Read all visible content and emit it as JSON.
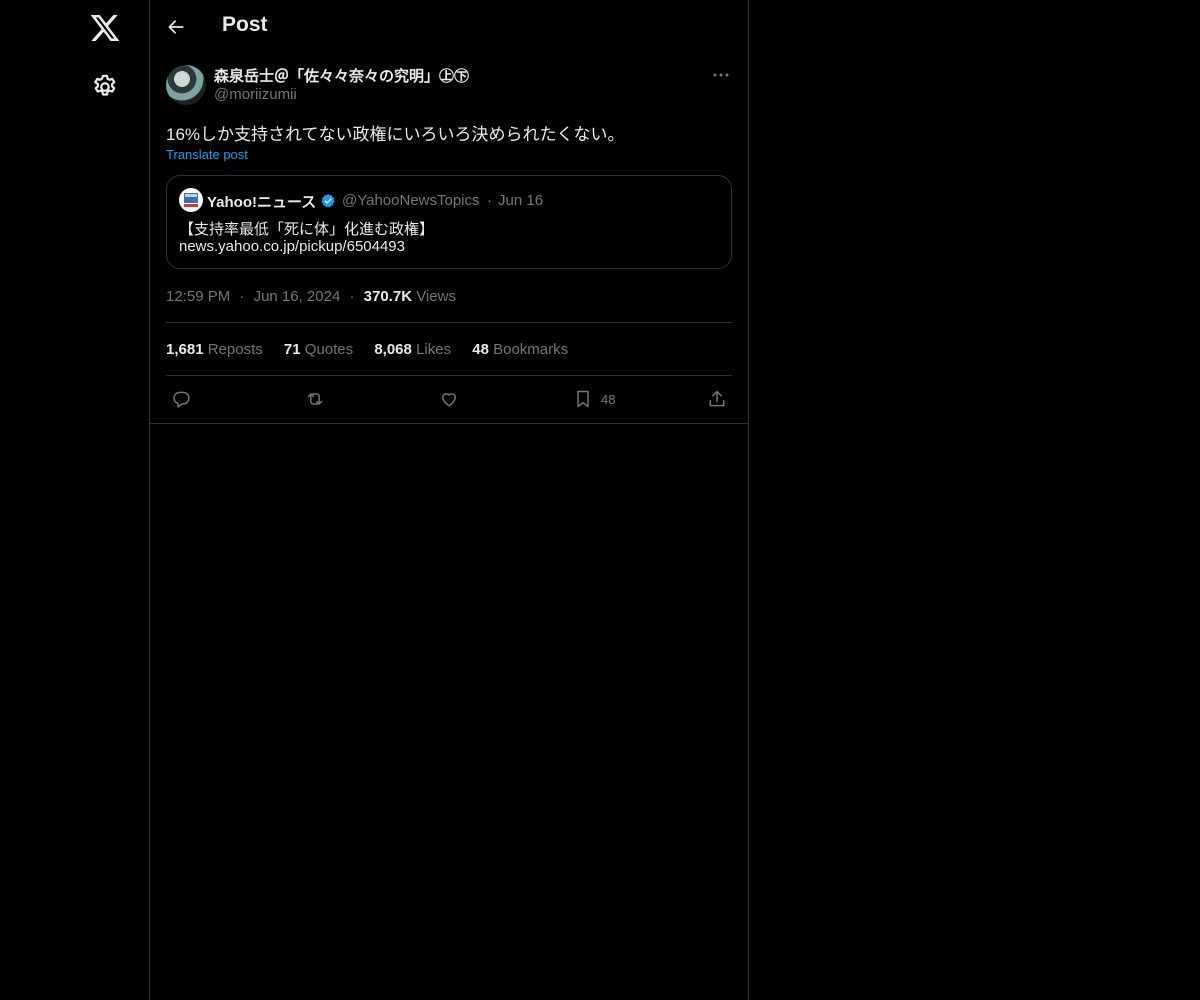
{
  "nav": {
    "logo_icon": "x-logo-icon",
    "settings_icon": "gear-icon"
  },
  "header": {
    "title": "Post",
    "back_icon": "arrow-left-icon"
  },
  "post": {
    "author_name": "森泉岳士＠「佐々々奈々の究明」㊤㊦",
    "author_handle": "@moriizumii",
    "text": "16%しか支持されてない政権にいろいろ決められたくない。",
    "translate_label": "Translate post",
    "quote": {
      "name": "Yahoo!ニュース",
      "handle": "@YahooNewsTopics",
      "separator": "·",
      "date": "Jun 16",
      "line1": "【支持率最低「死に体」化進む政権】",
      "line2": "news.yahoo.co.jp/pickup/6504493"
    },
    "meta": {
      "time": "12:59 PM",
      "dot": "·",
      "date": "Jun 16, 2024",
      "views_count": "370.7K",
      "views_label": "Views"
    },
    "stats": {
      "reposts_count": "1,681",
      "reposts_label": "Reposts",
      "quotes_count": "71",
      "quotes_label": "Quotes",
      "likes_count": "8,068",
      "likes_label": "Likes",
      "bookmarks_count": "48",
      "bookmarks_label": "Bookmarks"
    },
    "actions": {
      "bookmark_count": "48"
    }
  },
  "colors": {
    "background": "#000000",
    "text": "#e7e9ea",
    "muted": "#71767b",
    "border": "#2f3336",
    "accent": "#1d9bf0"
  }
}
